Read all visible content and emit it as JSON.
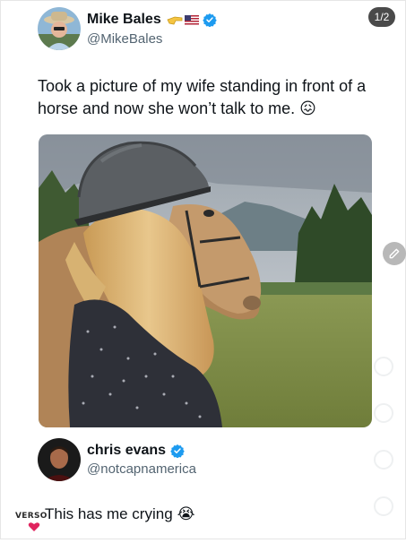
{
  "tweet": {
    "author_name": "Mike Bales",
    "author_handle": "@MikeBales",
    "text": "Took a picture of my wife standing in front of a horse and now she won’t talk to me. 😖",
    "page_indicator": "1/2",
    "emojis": [
      "pointing-hand-emoji",
      "us-flag-emoji"
    ]
  },
  "reply": {
    "author_name": "chris evans",
    "author_handle": "@notcapnamerica",
    "text": "This has me crying",
    "emoji": "😭"
  },
  "watermark": {
    "text": "VERSO"
  },
  "colors": {
    "verified": "#1d9bf0",
    "handle": "#536471",
    "text": "#0f1419"
  }
}
